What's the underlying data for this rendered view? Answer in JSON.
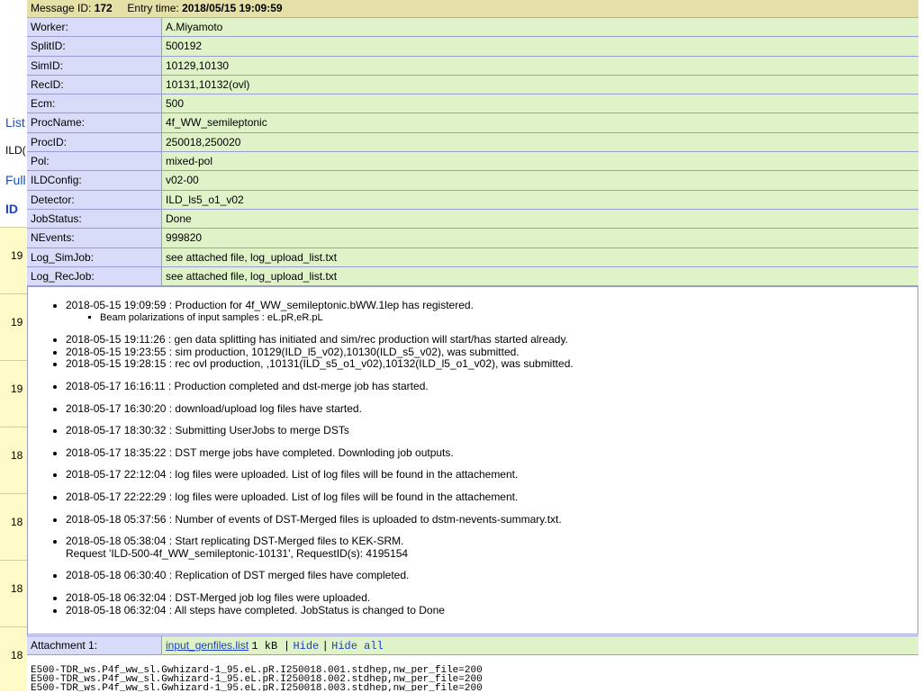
{
  "background": {
    "tabs": [
      "List",
      "ILD(",
      "Full",
      "ID"
    ],
    "row_ids": [
      "19",
      "19",
      "19",
      "18",
      "18",
      "18",
      "18"
    ]
  },
  "header": {
    "message_label": "Message ID:",
    "message_id": "172",
    "entry_label": "Entry time:",
    "entry_time": "2018/05/15 19:09:59"
  },
  "fields": [
    {
      "label": "Worker:",
      "value": "A.Miyamoto"
    },
    {
      "label": "SplitID:",
      "value": "500192"
    },
    {
      "label": "SimID:",
      "value": "10129,10130"
    },
    {
      "label": "RecID:",
      "value": "10131,10132(ovl)"
    },
    {
      "label": "Ecm:",
      "value": "500"
    },
    {
      "label": "ProcName:",
      "value": "4f_WW_semileptonic"
    },
    {
      "label": "ProcID:",
      "value": "250018,250020"
    },
    {
      "label": "Pol:",
      "value": "mixed-pol"
    },
    {
      "label": "ILDConfig:",
      "value": "v02-00"
    },
    {
      "label": "Detector:",
      "value": "ILD_ls5_o1_v02"
    },
    {
      "label": "JobStatus:",
      "value": "Done"
    },
    {
      "label": "NEvents:",
      "value": "999820"
    },
    {
      "label": "Log_SimJob:",
      "value": "see attached file, log_upload_list.txt"
    },
    {
      "label": "Log_RecJob:",
      "value": "see attached file, log_upload_list.txt"
    }
  ],
  "notes": {
    "item0": "2018-05-15 19:09:59 : Production for 4f_WW_semileptonic.bWW.1lep has registered.",
    "item0_sub": "Beam polarizations of input samples : eL.pR,eR.pL",
    "item1": "2018-05-15 19:11:26 : gen data splitting has initiated and sim/rec production will start/has started already.",
    "item2": "2018-05-15 19:23:55 : sim production, 10129(ILD_l5_v02),10130(ILD_s5_v02), was submitted.",
    "item3": "2018-05-15 19:28:15 : rec ovl production, ,10131(ILD_s5_o1_v02),10132(ILD_l5_o1_v02), was submitted.",
    "item4": "2018-05-17 16:16:11 : Production completed and dst-merge job has started.",
    "item5": "2018-05-17 16:30:20 : download/upload log files have started.",
    "item6": "2018-05-17 18:30:32 : Submitting UserJobs to merge DSTs",
    "item7": "2018-05-17 18:35:22 : DST merge jobs have completed. Downloding job outputs.",
    "item8": "2018-05-17 22:12:04 : log files were uploaded. List of log files will be found in the attachement.",
    "item9": "2018-05-17 22:22:29 : log files were uploaded. List of log files will be found in the attachement.",
    "item10": "2018-05-18 05:37:56 : Number of events of DST-Merged files is uploaded to dstm-nevents-summary.txt.",
    "item11a": "2018-05-18 05:38:04 : Start replicating DST-Merged files to KEK-SRM.",
    "item11b": "Request 'ILD-500-4f_WW_semileptonic-10131', RequestID(s): 4195154",
    "item12": "2018-05-18 06:30:40 : Replication of DST merged files have completed.",
    "item13": "2018-05-18 06:32:04 : DST-Merged job log files were uploaded.",
    "item14": "2018-05-18 06:32:04 : All steps have completed. JobStatus is changed to Done"
  },
  "attachment": {
    "label": "Attachment 1:",
    "filename": "input_genfiles.list",
    "size": "1 kB",
    "sep": "|",
    "hide": "Hide",
    "hide_all": "Hide all"
  },
  "filelist": [
    "E500-TDR_ws.P4f_ww_sl.Gwhizard-1_95.eL.pR.I250018.001.stdhep,nw_per_file=200",
    "E500-TDR_ws.P4f_ww_sl.Gwhizard-1_95.eL.pR.I250018.002.stdhep,nw_per_file=200",
    "E500-TDR_ws.P4f_ww_sl.Gwhizard-1_95.eL.pR.I250018.003.stdhep,nw_per_file=200"
  ]
}
